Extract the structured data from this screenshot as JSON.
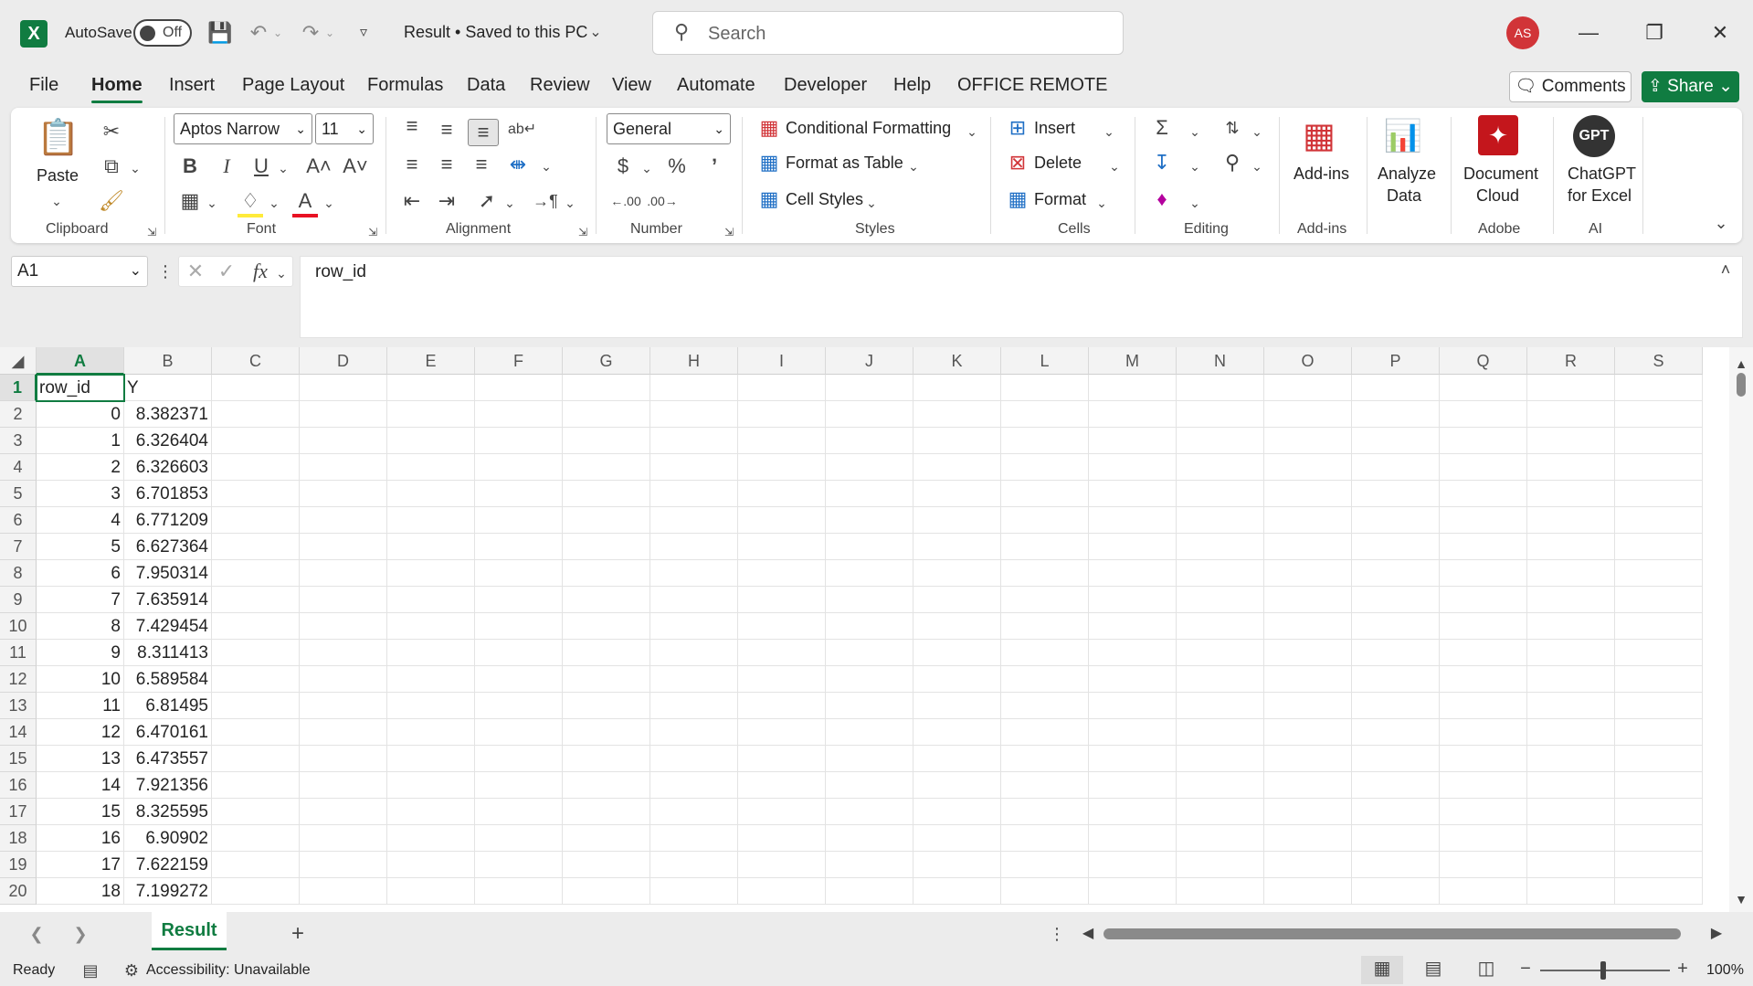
{
  "titlebar": {
    "autosave_label": "AutoSave",
    "autosave_state": "Off",
    "doc_title": "Result • Saved to this PC",
    "search_placeholder": "Search",
    "avatar_initials": "AS",
    "minimize": "—",
    "restore": "❐",
    "close": "✕"
  },
  "menu": {
    "items": [
      "File",
      "Home",
      "Insert",
      "Page Layout",
      "Formulas",
      "Data",
      "Review",
      "View",
      "Automate",
      "Developer",
      "Help",
      "OFFICE REMOTE"
    ],
    "active": "Home",
    "comments_label": "Comments",
    "share_label": "Share"
  },
  "ribbon": {
    "paste": "Paste",
    "font_name": "Aptos Narrow",
    "font_size": "11",
    "number_format": "General",
    "conditional_formatting": "Conditional Formatting",
    "format_as_table": "Format as Table",
    "cell_styles": "Cell Styles",
    "insert": "Insert",
    "delete": "Delete",
    "format": "Format",
    "add_ins": "Add-ins",
    "analyze_data_1": "Analyze",
    "analyze_data_2": "Data",
    "document_cloud_1": "Document",
    "document_cloud_2": "Cloud",
    "chatgpt_1": "ChatGPT",
    "chatgpt_2": "for Excel",
    "gpt_badge": "GPT",
    "groups": {
      "clipboard": "Clipboard",
      "font": "Font",
      "alignment": "Alignment",
      "number": "Number",
      "styles": "Styles",
      "cells": "Cells",
      "editing": "Editing",
      "add_ins": "Add-ins",
      "adobe": "Adobe",
      "ai": "AI"
    },
    "bold": "B",
    "italic": "I",
    "underline": "U",
    "grow_font": "A˄",
    "shrink_font": "A˅",
    "currency": "$",
    "percent": "%",
    "comma": "ʼ",
    "sum": "Σ"
  },
  "formula_bar": {
    "name_box": "A1",
    "fx": "fx",
    "content": "row_id"
  },
  "sheet": {
    "columns": [
      "A",
      "B",
      "C",
      "D",
      "E",
      "F",
      "G",
      "H",
      "I",
      "J",
      "K",
      "L",
      "M",
      "N",
      "O",
      "P",
      "Q",
      "R",
      "S"
    ],
    "header_row": [
      "row_id",
      "Y"
    ],
    "rows": [
      {
        "row_id": "0",
        "y": "8.382371"
      },
      {
        "row_id": "1",
        "y": "6.326404"
      },
      {
        "row_id": "2",
        "y": "6.326603"
      },
      {
        "row_id": "3",
        "y": "6.701853"
      },
      {
        "row_id": "4",
        "y": "6.771209"
      },
      {
        "row_id": "5",
        "y": "6.627364"
      },
      {
        "row_id": "6",
        "y": "7.950314"
      },
      {
        "row_id": "7",
        "y": "7.635914"
      },
      {
        "row_id": "8",
        "y": "7.429454"
      },
      {
        "row_id": "9",
        "y": "8.311413"
      },
      {
        "row_id": "10",
        "y": "6.589584"
      },
      {
        "row_id": "11",
        "y": "6.81495"
      },
      {
        "row_id": "12",
        "y": "6.470161"
      },
      {
        "row_id": "13",
        "y": "6.473557"
      },
      {
        "row_id": "14",
        "y": "7.921356"
      },
      {
        "row_id": "15",
        "y": "8.325595"
      },
      {
        "row_id": "16",
        "y": "6.90902"
      },
      {
        "row_id": "17",
        "y": "7.622159"
      },
      {
        "row_id": "18",
        "y": "7.199272"
      }
    ]
  },
  "tabs": {
    "sheet_name": "Result",
    "add": "+"
  },
  "status": {
    "ready": "Ready",
    "accessibility": "Accessibility: Unavailable",
    "zoom": "100%"
  },
  "colors": {
    "accent": "#107c41",
    "avatar": "#d13438",
    "adobe": "#c4161c"
  }
}
